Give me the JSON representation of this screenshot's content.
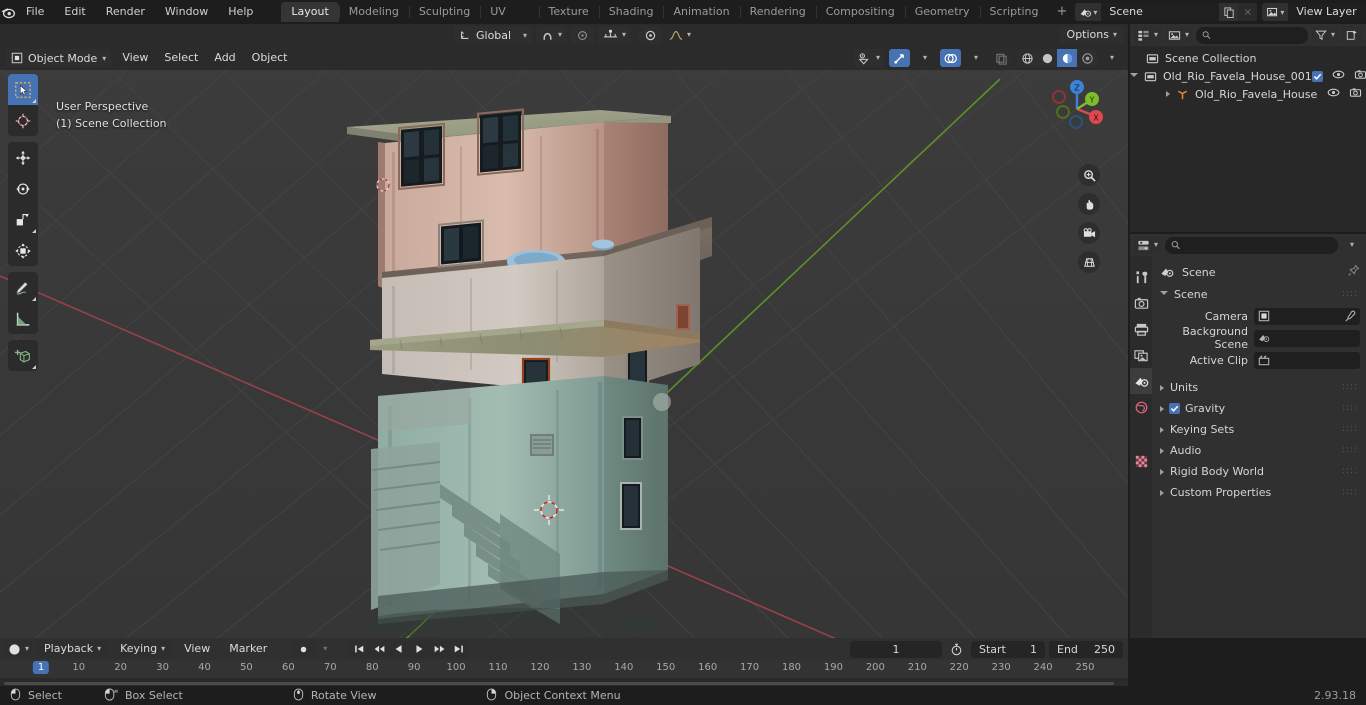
{
  "app": {
    "name": "Blender",
    "version": "2.93.18"
  },
  "topbar": {
    "menus": [
      "File",
      "Edit",
      "Render",
      "Window",
      "Help"
    ],
    "workspaces": [
      {
        "label": "Layout",
        "active": true
      },
      {
        "label": "Modeling",
        "active": false
      },
      {
        "label": "Sculpting",
        "active": false
      },
      {
        "label": "UV Editing",
        "active": false
      },
      {
        "label": "Texture Paint",
        "active": false
      },
      {
        "label": "Shading",
        "active": false
      },
      {
        "label": "Animation",
        "active": false
      },
      {
        "label": "Rendering",
        "active": false
      },
      {
        "label": "Compositing",
        "active": false
      },
      {
        "label": "Geometry Nodes",
        "active": false
      },
      {
        "label": "Scripting",
        "active": false
      }
    ],
    "add_workspace_label": "+",
    "scene": {
      "icon": "scene-icon",
      "name": "Scene",
      "new_label": "new-scene-icon",
      "unlink_label": "×"
    },
    "view_layer": {
      "icon": "view-layer-icon",
      "name": "View Layer",
      "new_label": "new-layer-icon",
      "unlink_label": "×"
    }
  },
  "viewport": {
    "mode": "Object Mode",
    "menus": [
      "View",
      "Select",
      "Add",
      "Object"
    ],
    "transform_orientation": "Global",
    "options_label": "Options",
    "overlay_text_line1": "User Perspective",
    "overlay_text_line2": "(1) Scene Collection",
    "gizmo_axes": [
      {
        "label": "Z",
        "color": "#3d81d8"
      },
      {
        "label": "Y",
        "color": "#7bbd2a"
      },
      {
        "label": "X",
        "color": "#e0484f"
      }
    ],
    "nav_buttons": [
      "zoom-icon",
      "pan-hand-icon",
      "camera-view-icon",
      "toggle-perspective-icon"
    ],
    "tools": [
      {
        "name": "tweak-select-tool",
        "selected": true
      },
      {
        "name": "cursor-tool",
        "selected": false
      },
      {
        "name": "move-tool",
        "selected": false
      },
      {
        "name": "rotate-tool",
        "selected": false
      },
      {
        "name": "scale-tool",
        "selected": false
      },
      {
        "name": "transform-tool",
        "selected": false
      },
      {
        "name": "annotate-tool",
        "selected": false
      },
      {
        "name": "measure-tool",
        "selected": false
      },
      {
        "name": "add-cube-tool",
        "selected": false
      }
    ],
    "shading_modes": [
      {
        "name": "wireframe",
        "active": false
      },
      {
        "name": "solid",
        "active": false
      },
      {
        "name": "material-preview",
        "active": true
      },
      {
        "name": "rendered",
        "active": false
      }
    ]
  },
  "outliner": {
    "display_mode": "view-layer-icon",
    "filter_icon": "filter-icon",
    "new_collection_icon": "new-collection-icon",
    "search_placeholder": "",
    "rows": [
      {
        "label": "Scene Collection",
        "indent": 0,
        "icon": "collection-icon",
        "expander": "none",
        "checkbox": false,
        "eye": false,
        "camera": false
      },
      {
        "label": "Old_Rio_Favela_House_001",
        "indent": 1,
        "icon": "collection-icon",
        "expander": "down",
        "checkbox": true,
        "eye": true,
        "camera": true
      },
      {
        "label": "Old_Rio_Favela_House",
        "indent": 2,
        "icon": "mesh-object-icon",
        "expander": "right",
        "checkbox": false,
        "eye": true,
        "camera": true
      }
    ]
  },
  "properties": {
    "editor_icon": "properties-editor-icon",
    "search_placeholder": "",
    "tabs": [
      {
        "name": "tool-tab",
        "icon": "tool-icon",
        "active": false,
        "color": "#c8c8c8"
      },
      {
        "name": "render-tab",
        "icon": "render-camera-icon",
        "active": false,
        "color": "#c8c8c8"
      },
      {
        "name": "output-tab",
        "icon": "printer-icon",
        "active": false,
        "color": "#c8c8c8"
      },
      {
        "name": "view-layer-tab",
        "icon": "images-icon",
        "active": false,
        "color": "#c8c8c8"
      },
      {
        "name": "scene-tab",
        "icon": "scene-icon",
        "active": true,
        "color": "#e0e0e0"
      },
      {
        "name": "world-tab",
        "icon": "world-globe-icon",
        "active": false,
        "color": "#d4647a"
      },
      {
        "name": "texture-tab",
        "icon": "checker-texture-icon",
        "active": false,
        "color": "#d4647a"
      }
    ],
    "breadcrumb": "Scene",
    "panels": [
      {
        "label": "Scene",
        "open": true,
        "type": "open"
      },
      {
        "label": "Units",
        "open": false,
        "type": "closed"
      },
      {
        "label": "Gravity",
        "open": false,
        "type": "closed",
        "checkbox": true
      },
      {
        "label": "Keying Sets",
        "open": false,
        "type": "closed"
      },
      {
        "label": "Audio",
        "open": false,
        "type": "closed"
      },
      {
        "label": "Rigid Body World",
        "open": false,
        "type": "closed"
      },
      {
        "label": "Custom Properties",
        "open": false,
        "type": "closed"
      }
    ],
    "fields": [
      {
        "label": "Camera",
        "value": "",
        "icon": "camera-data-icon",
        "action": "eyedropper-icon"
      },
      {
        "label": "Background Scene",
        "value": "",
        "icon": "scene-icon",
        "action": ""
      },
      {
        "label": "Active Clip",
        "value": "",
        "icon": "movie-clip-icon",
        "action": ""
      }
    ]
  },
  "timeline": {
    "editor_icon": "timeline-editor-icon",
    "menus": [
      "Playback",
      "Keying",
      "View",
      "Marker"
    ],
    "auto_key_icon": "record-icon",
    "transport": [
      "jump-to-start-icon",
      "jump-prev-keyframe-icon",
      "play-reverse-icon",
      "play-icon",
      "jump-next-keyframe-icon",
      "jump-to-end-icon"
    ],
    "current_frame": "1",
    "frame_icon": "stopwatch-icon",
    "start_label": "Start",
    "start_value": "1",
    "end_label": "End",
    "end_value": "250",
    "playhead_frame": "1",
    "ruler_ticks": [
      "10",
      "20",
      "30",
      "40",
      "50",
      "60",
      "70",
      "80",
      "90",
      "100",
      "110",
      "120",
      "130",
      "140",
      "150",
      "160",
      "170",
      "180",
      "190",
      "200",
      "210",
      "220",
      "230",
      "240",
      "250"
    ]
  },
  "statusbar": {
    "items": [
      {
        "icon": "mouse-left-icon",
        "label": "Select"
      },
      {
        "icon": "mouse-left-drag-icon",
        "label": "Box Select"
      },
      {
        "icon": "mouse-middle-icon",
        "label": "Rotate View"
      },
      {
        "icon": "mouse-right-icon",
        "label": "Object Context Menu"
      }
    ],
    "version": "2.93.18"
  },
  "colors": {
    "accent_blue": "#4772b3",
    "axis_x_red": "#b04040",
    "axis_y_green": "#6a9e2a",
    "bg_viewport": "#393939",
    "bg_panel": "#303030",
    "bg_editor": "#282828"
  }
}
